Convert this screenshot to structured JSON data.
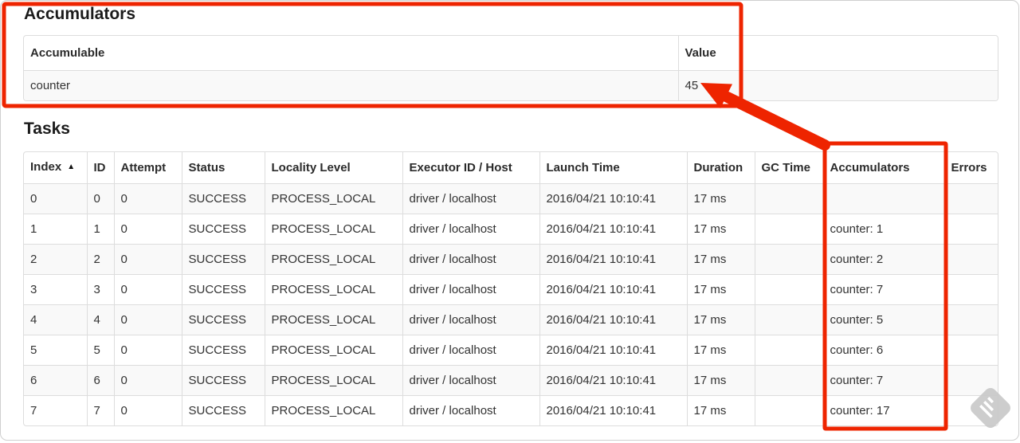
{
  "colors": {
    "annotation_red": "#ee2400",
    "table_border": "#dddddd",
    "stripe_row": "#f9f9f9",
    "watermark_gray": "#c9c9c9"
  },
  "accumulators_section": {
    "title": "Accumulators",
    "table": {
      "headers": [
        "Accumulable",
        "Value"
      ],
      "headers_clickable": false,
      "rows": [
        [
          "counter",
          "45"
        ]
      ]
    }
  },
  "tasks_section": {
    "title": "Tasks",
    "table": {
      "headers": [
        "Index",
        "ID",
        "Attempt",
        "Status",
        "Locality Level",
        "Executor ID / Host",
        "Launch Time",
        "Duration",
        "GC Time",
        "Accumulators",
        "Errors"
      ],
      "headers_clickable": true,
      "sort": {
        "index": 0,
        "indicator": "▲"
      },
      "rows": [
        [
          "0",
          "0",
          "0",
          "SUCCESS",
          "PROCESS_LOCAL",
          "driver / localhost",
          "2016/04/21 10:10:41",
          "17 ms",
          "",
          "",
          ""
        ],
        [
          "1",
          "1",
          "0",
          "SUCCESS",
          "PROCESS_LOCAL",
          "driver / localhost",
          "2016/04/21 10:10:41",
          "17 ms",
          "",
          "counter: 1",
          ""
        ],
        [
          "2",
          "2",
          "0",
          "SUCCESS",
          "PROCESS_LOCAL",
          "driver / localhost",
          "2016/04/21 10:10:41",
          "17 ms",
          "",
          "counter: 2",
          ""
        ],
        [
          "3",
          "3",
          "0",
          "SUCCESS",
          "PROCESS_LOCAL",
          "driver / localhost",
          "2016/04/21 10:10:41",
          "17 ms",
          "",
          "counter: 7",
          ""
        ],
        [
          "4",
          "4",
          "0",
          "SUCCESS",
          "PROCESS_LOCAL",
          "driver / localhost",
          "2016/04/21 10:10:41",
          "17 ms",
          "",
          "counter: 5",
          ""
        ],
        [
          "5",
          "5",
          "0",
          "SUCCESS",
          "PROCESS_LOCAL",
          "driver / localhost",
          "2016/04/21 10:10:41",
          "17 ms",
          "",
          "counter: 6",
          ""
        ],
        [
          "6",
          "6",
          "0",
          "SUCCESS",
          "PROCESS_LOCAL",
          "driver / localhost",
          "2016/04/21 10:10:41",
          "17 ms",
          "",
          "counter: 7",
          ""
        ],
        [
          "7",
          "7",
          "0",
          "SUCCESS",
          "PROCESS_LOCAL",
          "driver / localhost",
          "2016/04/21 10:10:41",
          "17 ms",
          "",
          "counter: 17",
          ""
        ]
      ]
    }
  }
}
